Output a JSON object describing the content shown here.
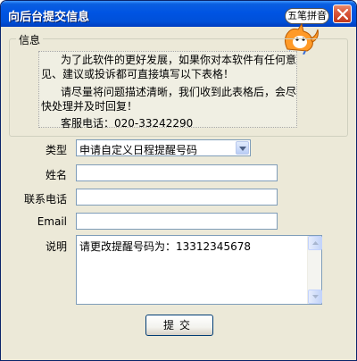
{
  "window": {
    "title": "向后台提交信息"
  },
  "ime": {
    "label": "五笔拼音"
  },
  "info_group": {
    "legend": "信息",
    "lines": [
      "为了此软件的更好发展，如果你对本软件有任何意",
      "见、建议或投诉都可直接填写以下表格！",
      "请尽量将问题描述清晰，我们收到此表格后，会尽",
      "快处理并及时回复！",
      "客服电话：020-33242290"
    ]
  },
  "form": {
    "type_label": "类型",
    "type_value": "申请自定义日程提醒号码",
    "name_label": "姓名",
    "name_value": "",
    "phone_label": "联系电话",
    "phone_value": "",
    "email_label": "Email",
    "email_value": "",
    "desc_label": "说明",
    "desc_value": "请更改提醒号码为：13312345678"
  },
  "actions": {
    "submit_label": "提交"
  }
}
